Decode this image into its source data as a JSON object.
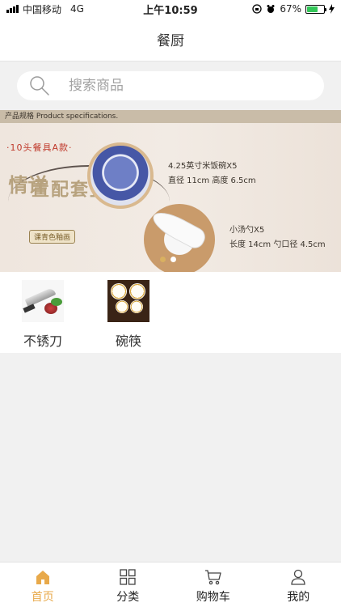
{
  "status_bar": {
    "carrier": "中国移动",
    "network": "4G",
    "time": "上午10:59",
    "battery_percent": "67%",
    "battery_level": 0.67
  },
  "nav": {
    "title": "餐厨"
  },
  "search": {
    "placeholder": "搜索商品"
  },
  "banner": {
    "header": "产品规格 Product specifications.",
    "tag": "·10头餐具A款·",
    "vertical_title_col1": "详情",
    "vertical_title_col2": "整套配置",
    "stamp": "课青色釉画",
    "spec1_name": "4.25英寸米饭碗X5",
    "spec1_dims": "直径 11cm   高度 6.5cm",
    "spec2_name": "小汤勺X5",
    "spec2_dims": "长度 14cm   勺口径  4.5cm",
    "active_slide": 2,
    "slide_count": 2
  },
  "categories": [
    {
      "label": "不锈刀",
      "icon": "knife-product-image"
    },
    {
      "label": "碗筷",
      "icon": "tableware-set-image"
    }
  ],
  "tab_bar": {
    "tabs": [
      {
        "label": "首页",
        "icon": "home-icon",
        "active": true
      },
      {
        "label": "分类",
        "icon": "grid-icon",
        "active": false
      },
      {
        "label": "购物车",
        "icon": "cart-icon",
        "active": false
      },
      {
        "label": "我的",
        "icon": "user-icon",
        "active": false
      }
    ],
    "accent_color": "#e8a94a"
  }
}
